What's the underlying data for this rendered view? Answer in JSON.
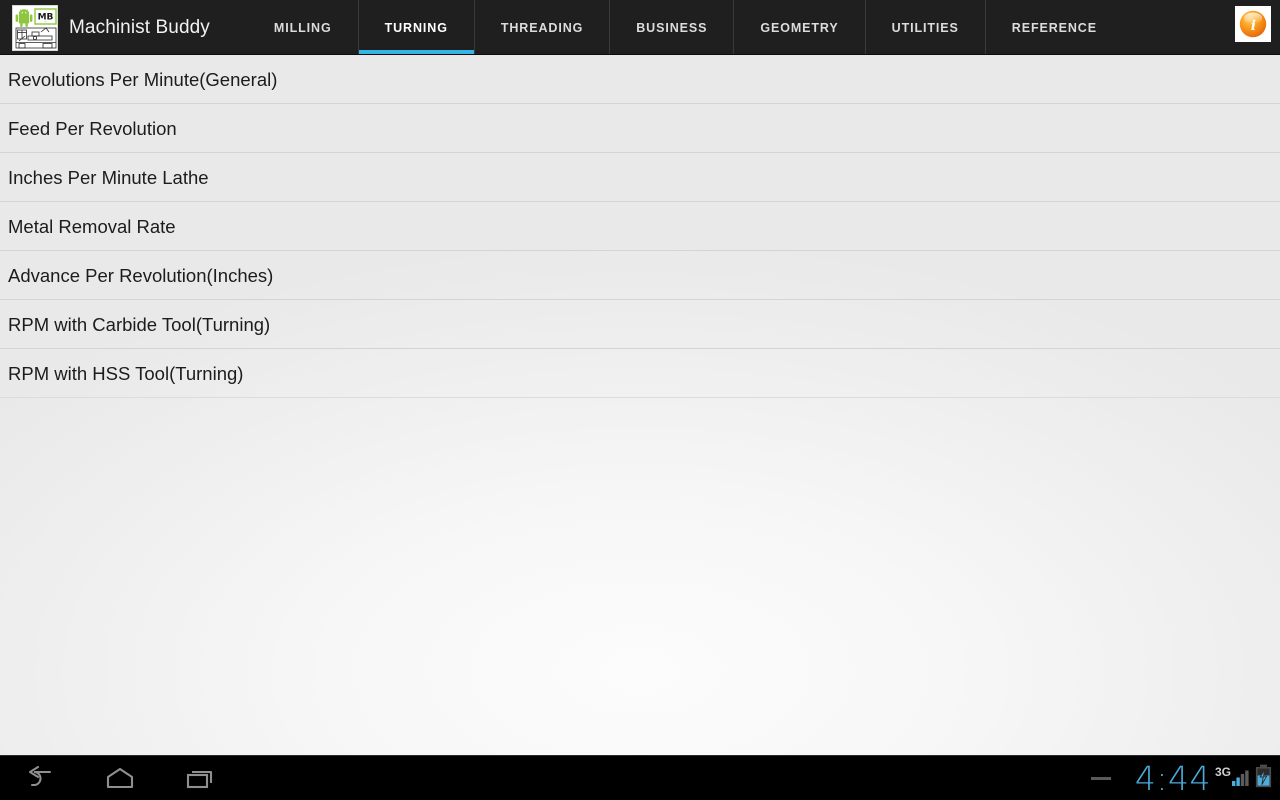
{
  "app": {
    "title": "Machinist Buddy",
    "icon_name": "machinist-buddy-lathe-icon",
    "icon_badge_text": "MB"
  },
  "action_bar": {
    "info_icon": "info-circle-icon",
    "tabs": [
      {
        "label": "MILLING",
        "active": false
      },
      {
        "label": "TURNING",
        "active": true
      },
      {
        "label": "THREADING",
        "active": false
      },
      {
        "label": "BUSINESS",
        "active": false
      },
      {
        "label": "GEOMETRY",
        "active": false
      },
      {
        "label": "UTILITIES",
        "active": false
      },
      {
        "label": "REFERENCE",
        "active": false
      }
    ],
    "active_tab": "TURNING",
    "accent_color": "#33b5e5",
    "background_color": "#1f1f1f"
  },
  "content": {
    "list_items": [
      {
        "label": "Revolutions Per Minute(General)"
      },
      {
        "label": "Feed Per Revolution"
      },
      {
        "label": "Inches Per Minute Lathe"
      },
      {
        "label": "Metal Removal Rate"
      },
      {
        "label": "Advance Per Revolution(Inches)"
      },
      {
        "label": "RPM with Carbide Tool(Turning)"
      },
      {
        "label": "RPM with HSS Tool(Turning)"
      }
    ]
  },
  "nav_bar": {
    "keys": [
      {
        "name": "back-icon"
      },
      {
        "name": "home-icon"
      },
      {
        "name": "recents-icon"
      }
    ],
    "status": {
      "notification_dash": "notification-dash-icon",
      "clock": "4:44",
      "clock_color": "#4aaddb",
      "network_type": "3G",
      "signal_icon": "signal-bars-icon",
      "battery_icon": "battery-charging-icon"
    }
  }
}
